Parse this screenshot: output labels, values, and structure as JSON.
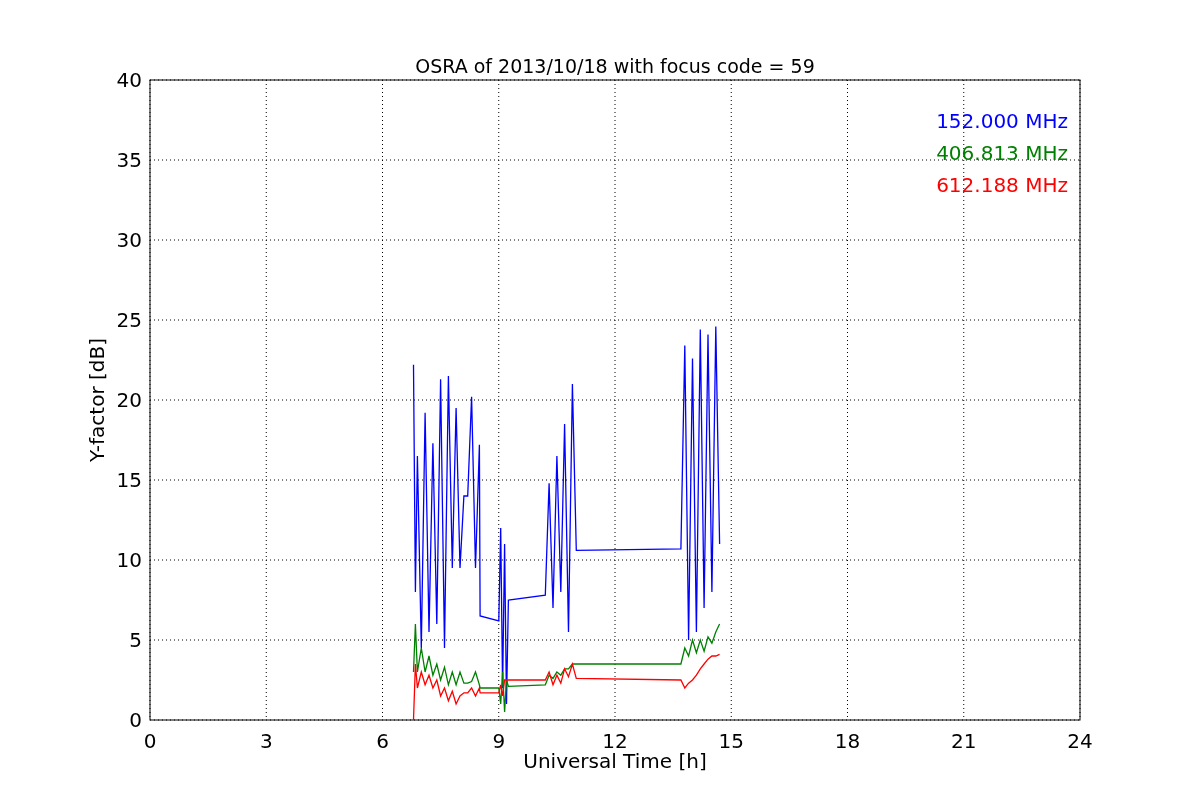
{
  "chart_data": {
    "type": "line",
    "title": "OSRA of 2013/10/18 with focus code = 59",
    "xlabel": "Universal Time [h]",
    "ylabel": "Y-factor [dB]",
    "x": [
      6.8,
      6.85,
      6.9,
      7.0,
      7.1,
      7.2,
      7.3,
      7.4,
      7.5,
      7.6,
      7.7,
      7.8,
      7.9,
      8.0,
      8.1,
      8.2,
      8.3,
      8.4,
      8.5,
      8.52,
      9.0,
      9.05,
      9.1,
      9.15,
      9.2,
      9.25,
      10.2,
      10.3,
      10.4,
      10.5,
      10.6,
      10.7,
      10.8,
      10.9,
      11.0,
      13.7,
      13.8,
      13.9,
      14.0,
      14.1,
      14.2,
      14.3,
      14.4,
      14.5,
      14.6,
      14.7
    ],
    "series": [
      {
        "name": "152.000 MHz",
        "color": "#0000ff",
        "values": [
          22.2,
          8,
          16.5,
          4.5,
          19.2,
          5.5,
          17.3,
          6,
          21.3,
          4.5,
          21.5,
          9.5,
          19.5,
          9.5,
          14,
          14,
          20.2,
          9.5,
          17.2,
          6.5,
          6.2,
          12,
          2,
          11,
          1,
          7.5,
          7.8,
          14.8,
          7,
          16.5,
          8,
          18.5,
          5.5,
          21,
          10.6,
          10.7,
          23.4,
          5,
          22.6,
          5.5,
          24.4,
          7,
          24.1,
          8,
          24.6,
          11
        ]
      },
      {
        "name": "406.813 MHz",
        "color": "#008000",
        "values": [
          3,
          6,
          3,
          4.5,
          3,
          4,
          2.8,
          3.5,
          2.5,
          3.3,
          2.2,
          3,
          2.2,
          3,
          2.3,
          2.3,
          2.4,
          3,
          2.2,
          2,
          2,
          1,
          3,
          0.5,
          2.5,
          2.1,
          2.2,
          2.8,
          2.6,
          3,
          2.8,
          3.2,
          3.2,
          3.5,
          3.5,
          3.5,
          4.5,
          4,
          5,
          4.2,
          5,
          4.3,
          5.2,
          4.8,
          5.5,
          6
        ]
      },
      {
        "name": "612.188 MHz",
        "color": "#ff0000",
        "values": [
          0,
          3.5,
          2,
          3,
          2.2,
          2.8,
          2,
          2.5,
          1.5,
          2,
          1.2,
          1.8,
          1,
          1.5,
          1.7,
          1.7,
          2,
          1.5,
          2,
          1.7,
          1.7,
          2.2,
          1.5,
          2.5,
          2.5,
          2.5,
          2.5,
          3,
          2.2,
          2.8,
          2.3,
          3.2,
          2.7,
          3.5,
          2.6,
          2.5,
          2,
          2.3,
          2.5,
          2.8,
          3.2,
          3.5,
          3.8,
          4,
          4,
          4.1
        ]
      }
    ],
    "xlim": [
      0,
      24
    ],
    "ylim": [
      0,
      40
    ],
    "xticks": [
      0,
      3,
      6,
      9,
      12,
      15,
      18,
      21,
      24
    ],
    "yticks": [
      0,
      5,
      10,
      15,
      20,
      25,
      30,
      35,
      40
    ],
    "grid": true
  }
}
